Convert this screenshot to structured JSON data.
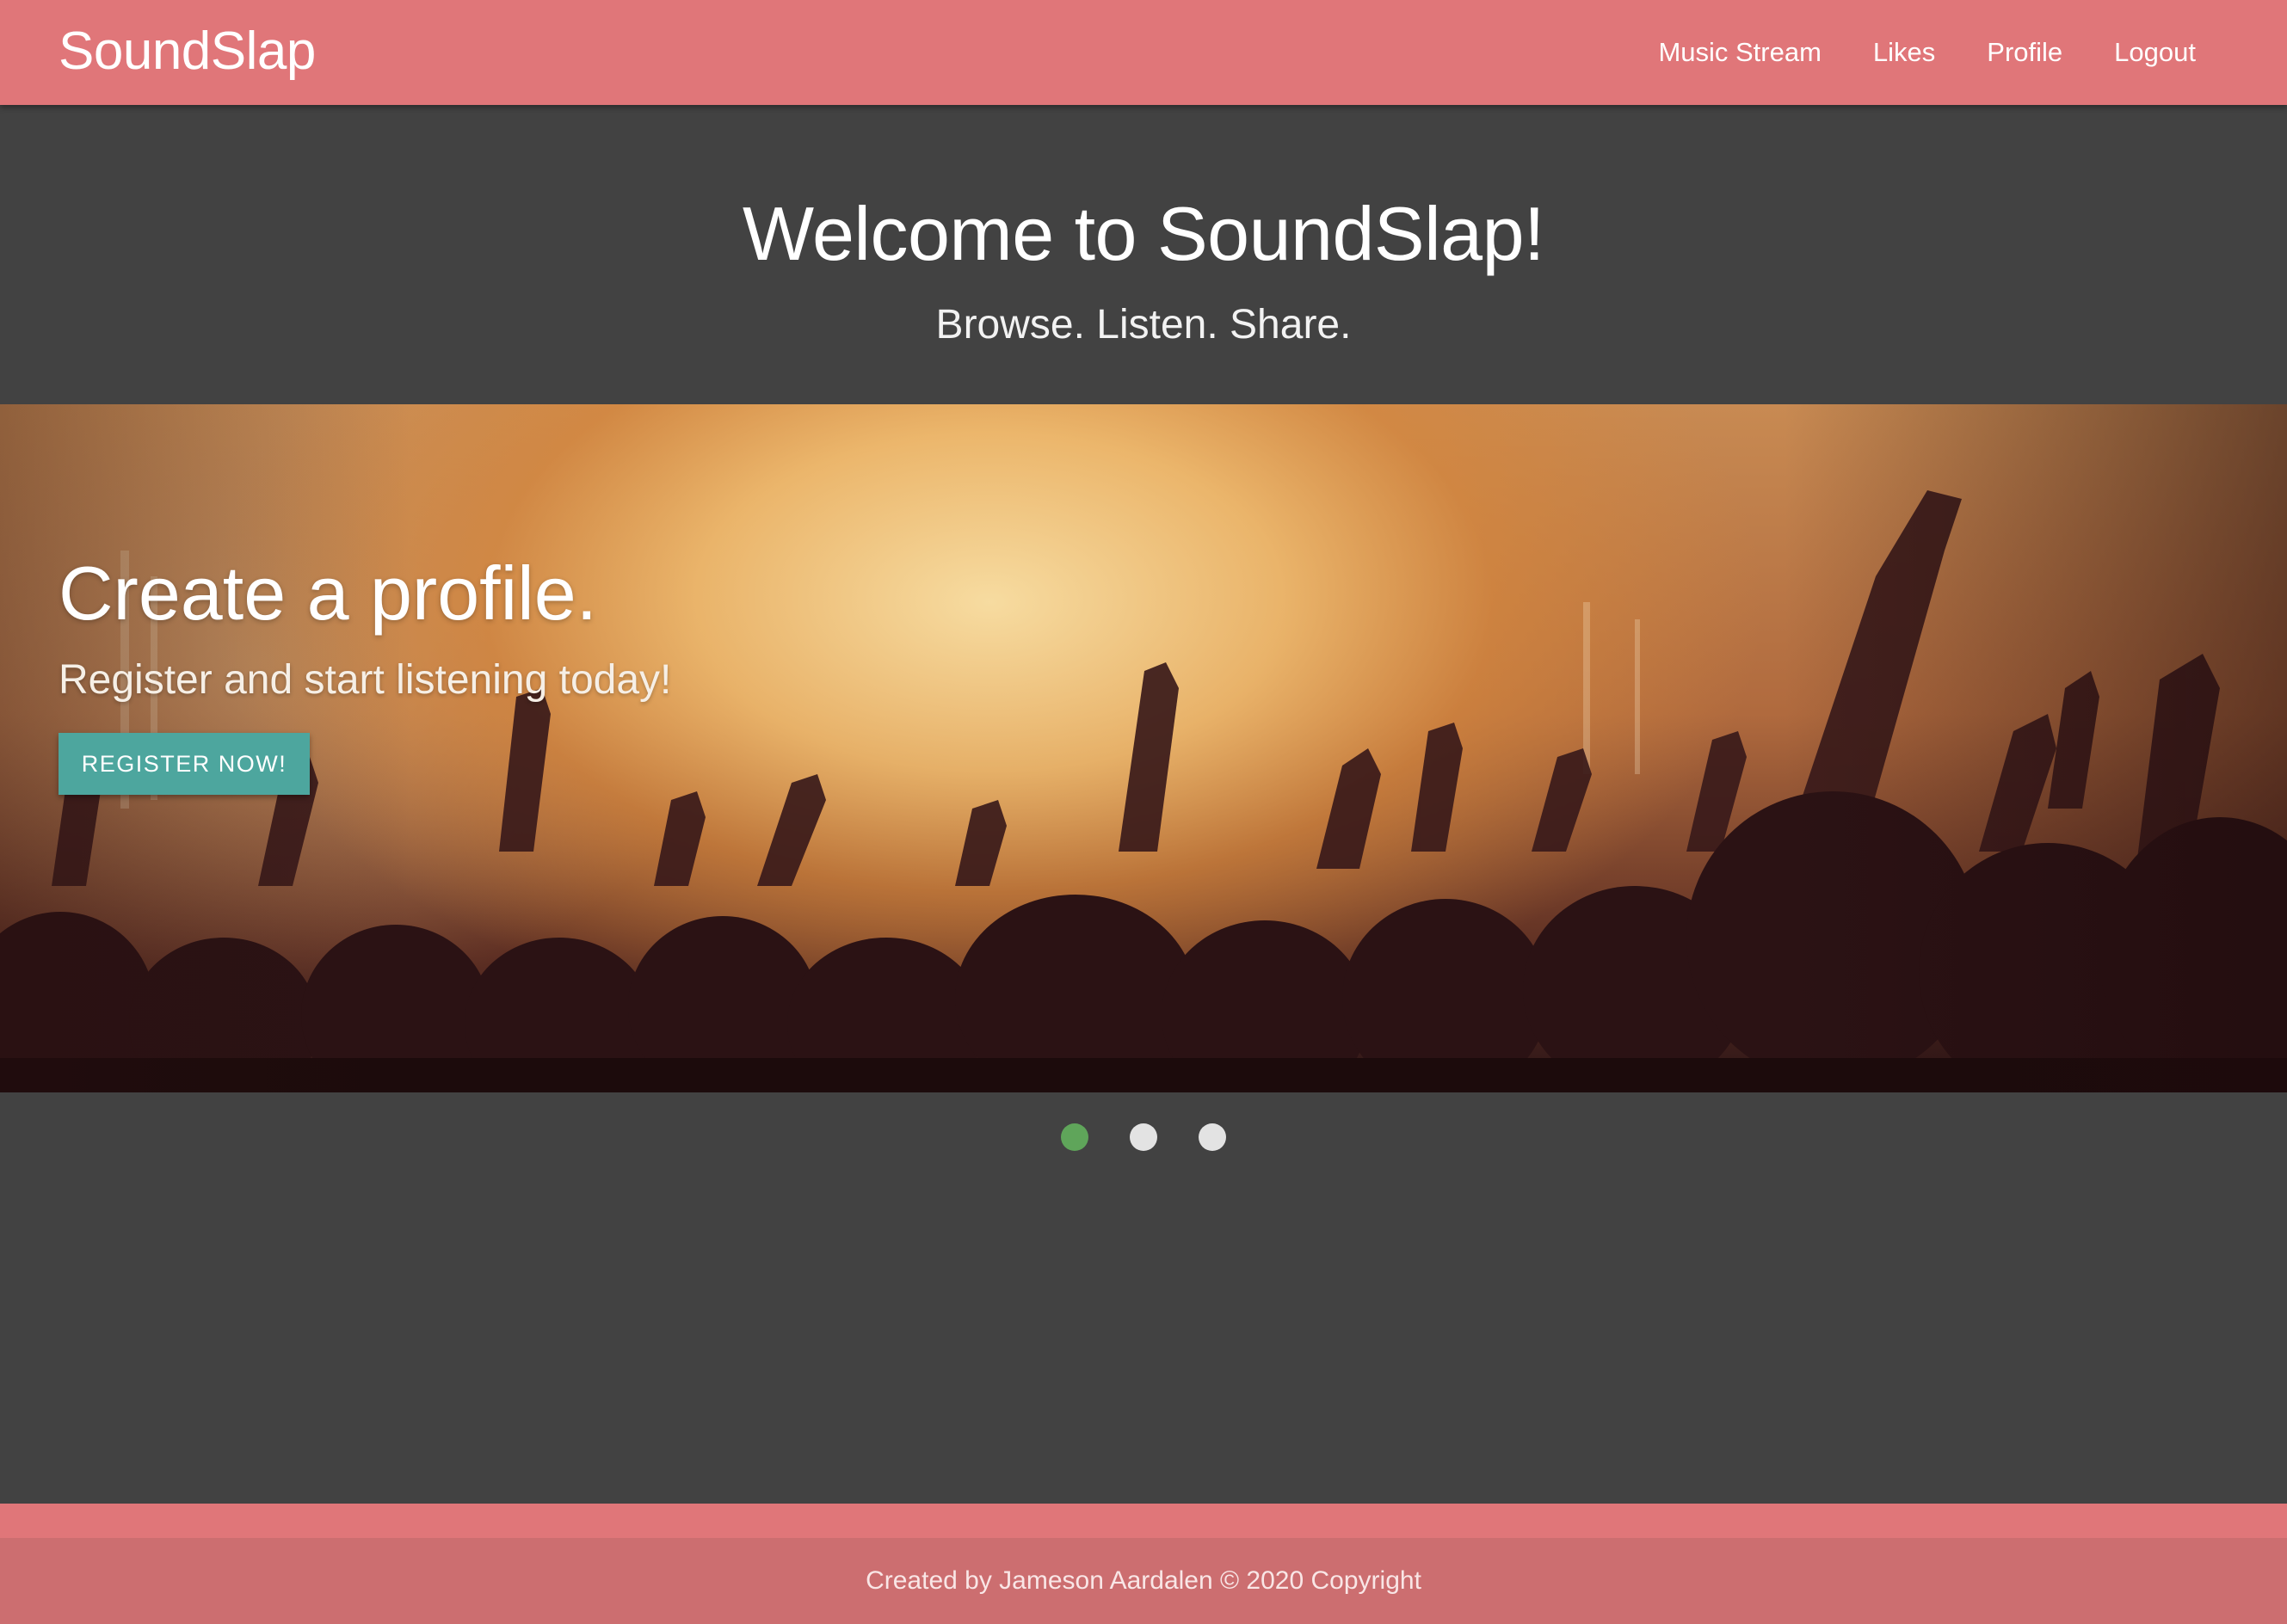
{
  "navbar": {
    "brand": "SoundSlap",
    "links": [
      {
        "label": "Music Stream"
      },
      {
        "label": "Likes"
      },
      {
        "label": "Profile"
      },
      {
        "label": "Logout"
      }
    ]
  },
  "hero": {
    "title": "Welcome to SoundSlap!",
    "subtitle": "Browse. Listen. Share."
  },
  "carousel": {
    "active_index": 0,
    "slide_count": 3,
    "slide": {
      "title": "Create a profile.",
      "text": "Register and start listening today!",
      "button_label": "REGISTER NOW!"
    }
  },
  "footer": {
    "text": "Created by Jameson Aardalen © 2020 Copyright"
  },
  "colors": {
    "navbar": "#e07679",
    "background": "#424242",
    "button": "#4da69e",
    "indicator_active": "#5fa55a",
    "indicator_inactive": "#e3e3e3",
    "footer_bottom": "#cc6e70"
  },
  "icons": [
    "concert-crowd-image"
  ]
}
